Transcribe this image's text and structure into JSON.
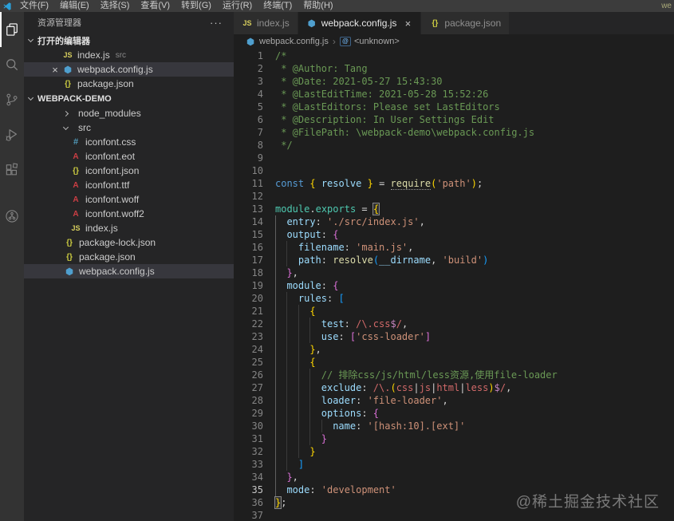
{
  "window": {
    "menus": [
      "文件(F)",
      "编辑(E)",
      "选择(S)",
      "查看(V)",
      "转到(G)",
      "运行(R)",
      "终端(T)",
      "帮助(H)"
    ],
    "title_right": "we"
  },
  "activity_bar": {
    "items": [
      {
        "name": "explorer-icon",
        "active": true
      },
      {
        "name": "search-icon",
        "active": false
      },
      {
        "name": "source-control-icon",
        "active": false
      },
      {
        "name": "run-debug-icon",
        "active": false
      },
      {
        "name": "extensions-icon",
        "active": false
      },
      {
        "name": "remote-explorer-icon",
        "active": false,
        "gap": true
      }
    ]
  },
  "sidebar": {
    "title": "资源管理器",
    "actions": "···",
    "open_editors": {
      "label": "打开的编辑器",
      "items": [
        {
          "label": "index.js",
          "detail": "src",
          "icon": "js",
          "selected": false,
          "close": false
        },
        {
          "label": "webpack.config.js",
          "detail": "",
          "icon": "webpack",
          "selected": true,
          "close": true
        },
        {
          "label": "package.json",
          "detail": "",
          "icon": "json",
          "selected": false,
          "close": false
        }
      ]
    },
    "project": {
      "label": "WEBPACK-DEMO",
      "tree": [
        {
          "label": "node_modules",
          "kind": "folder",
          "expanded": false,
          "level": 0,
          "selected": false
        },
        {
          "label": "src",
          "kind": "folder",
          "expanded": true,
          "level": 0,
          "selected": false
        },
        {
          "label": "iconfont.css",
          "kind": "file",
          "icon": "css",
          "level": 1,
          "selected": false
        },
        {
          "label": "iconfont.eot",
          "kind": "file",
          "icon": "font",
          "level": 1,
          "selected": false
        },
        {
          "label": "iconfont.json",
          "kind": "file",
          "icon": "json",
          "level": 1,
          "selected": false
        },
        {
          "label": "iconfont.ttf",
          "kind": "file",
          "icon": "font",
          "level": 1,
          "selected": false
        },
        {
          "label": "iconfont.woff",
          "kind": "file",
          "icon": "font",
          "level": 1,
          "selected": false
        },
        {
          "label": "iconfont.woff2",
          "kind": "file",
          "icon": "font",
          "level": 1,
          "selected": false
        },
        {
          "label": "index.js",
          "kind": "file",
          "icon": "js",
          "level": 1,
          "selected": false
        },
        {
          "label": "package-lock.json",
          "kind": "file",
          "icon": "json",
          "level": 0,
          "selected": false
        },
        {
          "label": "package.json",
          "kind": "file",
          "icon": "json",
          "level": 0,
          "selected": false
        },
        {
          "label": "webpack.config.js",
          "kind": "file",
          "icon": "webpack",
          "level": 0,
          "selected": true
        }
      ]
    }
  },
  "tabs": [
    {
      "label": "index.js",
      "icon": "js",
      "active": false,
      "close": false
    },
    {
      "label": "webpack.config.js",
      "icon": "webpack",
      "active": true,
      "close": true
    },
    {
      "label": "package.json",
      "icon": "json",
      "active": false,
      "close": false
    }
  ],
  "breadcrumb": {
    "file": "webpack.config.js",
    "symbol": "<unknown>",
    "symbol_badge": "@"
  },
  "editor": {
    "lines": [
      {
        "n": 1,
        "i": 0,
        "t": [
          [
            "/*",
            "cm"
          ]
        ]
      },
      {
        "n": 2,
        "i": 0,
        "t": [
          [
            " * @Author: Tang",
            "cm"
          ]
        ]
      },
      {
        "n": 3,
        "i": 0,
        "t": [
          [
            " * @Date: 2021-05-27 15:43:30",
            "cm"
          ]
        ]
      },
      {
        "n": 4,
        "i": 0,
        "t": [
          [
            " * @LastEditTime: 2021-05-28 15:52:26",
            "cm"
          ]
        ]
      },
      {
        "n": 5,
        "i": 0,
        "t": [
          [
            " * @LastEditors: Please set LastEditors",
            "cm"
          ]
        ]
      },
      {
        "n": 6,
        "i": 0,
        "t": [
          [
            " * @Description: In User Settings Edit",
            "cm"
          ]
        ]
      },
      {
        "n": 7,
        "i": 0,
        "t": [
          [
            " * @FilePath: \\webpack-demo\\webpack.config.js",
            "cm"
          ]
        ]
      },
      {
        "n": 8,
        "i": 0,
        "t": [
          [
            " */",
            "cm"
          ]
        ]
      },
      {
        "n": 9,
        "i": 0,
        "t": []
      },
      {
        "n": 10,
        "i": 0,
        "t": []
      },
      {
        "n": 11,
        "i": 0,
        "t": [
          [
            "const ",
            "kw"
          ],
          [
            "{ ",
            "b1"
          ],
          [
            "resolve",
            "vr"
          ],
          [
            " ",
            "op"
          ],
          [
            "}",
            "b1"
          ],
          [
            " = ",
            "op"
          ],
          [
            "require",
            "fn uds"
          ],
          [
            "(",
            "b1"
          ],
          [
            "'path'",
            "st"
          ],
          [
            ")",
            "b1"
          ],
          [
            ";",
            "op"
          ]
        ]
      },
      {
        "n": 12,
        "i": 0,
        "t": []
      },
      {
        "n": 13,
        "i": 0,
        "t": [
          [
            "module",
            "md"
          ],
          [
            ".",
            "op"
          ],
          [
            "exports",
            "md"
          ],
          [
            " = ",
            "op"
          ],
          [
            "{",
            "b1 bx"
          ]
        ]
      },
      {
        "n": 14,
        "i": 1,
        "t": [
          [
            "entry",
            "pr"
          ],
          [
            ": ",
            "op"
          ],
          [
            "'./src/index.js'",
            "st"
          ],
          [
            ",",
            "op"
          ]
        ]
      },
      {
        "n": 15,
        "i": 1,
        "t": [
          [
            "output",
            "pr"
          ],
          [
            ": ",
            "op"
          ],
          [
            "{",
            "b2"
          ]
        ]
      },
      {
        "n": 16,
        "i": 2,
        "t": [
          [
            "filename",
            "pr"
          ],
          [
            ": ",
            "op"
          ],
          [
            "'main.js'",
            "st"
          ],
          [
            ",",
            "op"
          ]
        ]
      },
      {
        "n": 17,
        "i": 2,
        "t": [
          [
            "path",
            "pr"
          ],
          [
            ": ",
            "op"
          ],
          [
            "resolve",
            "fn"
          ],
          [
            "(",
            "b3"
          ],
          [
            "__dirname",
            "vr"
          ],
          [
            ", ",
            "op"
          ],
          [
            "'build'",
            "st"
          ],
          [
            ")",
            "b3"
          ]
        ]
      },
      {
        "n": 18,
        "i": 1,
        "t": [
          [
            "}",
            "b2"
          ],
          [
            ",",
            "op"
          ]
        ]
      },
      {
        "n": 19,
        "i": 1,
        "t": [
          [
            "module",
            "pr"
          ],
          [
            ": ",
            "op"
          ],
          [
            "{",
            "b2"
          ]
        ]
      },
      {
        "n": 20,
        "i": 2,
        "t": [
          [
            "rules",
            "pr"
          ],
          [
            ": ",
            "op"
          ],
          [
            "[",
            "b3"
          ]
        ]
      },
      {
        "n": 21,
        "i": 3,
        "t": [
          [
            "{",
            "b1"
          ]
        ]
      },
      {
        "n": 22,
        "i": 4,
        "t": [
          [
            "test",
            "pr"
          ],
          [
            ": ",
            "op"
          ],
          [
            "/\\.css",
            "re"
          ],
          [
            "$",
            "ra"
          ],
          [
            "/",
            "re"
          ],
          [
            ",",
            "op"
          ]
        ]
      },
      {
        "n": 23,
        "i": 4,
        "t": [
          [
            "use",
            "pr"
          ],
          [
            ": ",
            "op"
          ],
          [
            "[",
            "b2"
          ],
          [
            "'css-loader'",
            "st"
          ],
          [
            "]",
            "b2"
          ]
        ]
      },
      {
        "n": 24,
        "i": 3,
        "t": [
          [
            "}",
            "b1"
          ],
          [
            ",",
            "op"
          ]
        ]
      },
      {
        "n": 25,
        "i": 3,
        "t": [
          [
            "{",
            "b1"
          ]
        ]
      },
      {
        "n": 26,
        "i": 4,
        "t": [
          [
            "// 排除css/js/html/less资源,使用file-loader",
            "cm"
          ]
        ]
      },
      {
        "n": 27,
        "i": 4,
        "t": [
          [
            "exclude",
            "pr"
          ],
          [
            ": ",
            "op"
          ],
          [
            "/\\.",
            "re"
          ],
          [
            "(",
            "b1"
          ],
          [
            "css",
            "re"
          ],
          [
            "|",
            "op"
          ],
          [
            "js",
            "re"
          ],
          [
            "|",
            "op"
          ],
          [
            "html",
            "re"
          ],
          [
            "|",
            "op"
          ],
          [
            "less",
            "re"
          ],
          [
            ")",
            "b1"
          ],
          [
            "$",
            "ra"
          ],
          [
            "/",
            "re"
          ],
          [
            ",",
            "op"
          ]
        ]
      },
      {
        "n": 28,
        "i": 4,
        "t": [
          [
            "loader",
            "pr"
          ],
          [
            ": ",
            "op"
          ],
          [
            "'file-loader'",
            "st"
          ],
          [
            ",",
            "op"
          ]
        ]
      },
      {
        "n": 29,
        "i": 4,
        "t": [
          [
            "options",
            "pr"
          ],
          [
            ": ",
            "op"
          ],
          [
            "{",
            "b2"
          ]
        ]
      },
      {
        "n": 30,
        "i": 5,
        "t": [
          [
            "name",
            "pr"
          ],
          [
            ": ",
            "op"
          ],
          [
            "'[hash:10].[ext]'",
            "st"
          ]
        ]
      },
      {
        "n": 31,
        "i": 4,
        "t": [
          [
            "}",
            "b2"
          ]
        ]
      },
      {
        "n": 32,
        "i": 3,
        "t": [
          [
            "}",
            "b1"
          ]
        ]
      },
      {
        "n": 33,
        "i": 2,
        "t": [
          [
            "]",
            "b3"
          ]
        ]
      },
      {
        "n": 34,
        "i": 1,
        "t": [
          [
            "}",
            "b2"
          ],
          [
            ",",
            "op"
          ]
        ]
      },
      {
        "n": 35,
        "i": 1,
        "t": [
          [
            "mode",
            "pr"
          ],
          [
            ": ",
            "op"
          ],
          [
            "'development'",
            "st"
          ]
        ],
        "active": true
      },
      {
        "n": 36,
        "i": 0,
        "t": [
          [
            "}",
            "b1 bx"
          ],
          [
            ";",
            "op"
          ]
        ]
      },
      {
        "n": 37,
        "i": 0,
        "t": []
      }
    ]
  },
  "watermark": "@稀土掘金技术社区",
  "colors": {
    "titlebar": "#3c3c3c",
    "activitybar": "#333333",
    "sidebar": "#252526",
    "editor": "#1e1e1e",
    "selection_row": "#37373d",
    "comment": "#6a9955",
    "keyword": "#569cd6",
    "property": "#9cdcfe",
    "string": "#ce9178",
    "function": "#dcdcaa",
    "module": "#4ec9b0",
    "bracket1": "#ffd700",
    "bracket2": "#da70d6",
    "bracket3": "#179fff",
    "regex": "#d16969",
    "regex_anchor": "#c586c0",
    "js_icon": "#d8cf5e",
    "json_icon": "#cbcb41",
    "css_icon": "#519aba",
    "font_icon": "#cc3e44",
    "webpack_icon": "#4f9fce"
  }
}
